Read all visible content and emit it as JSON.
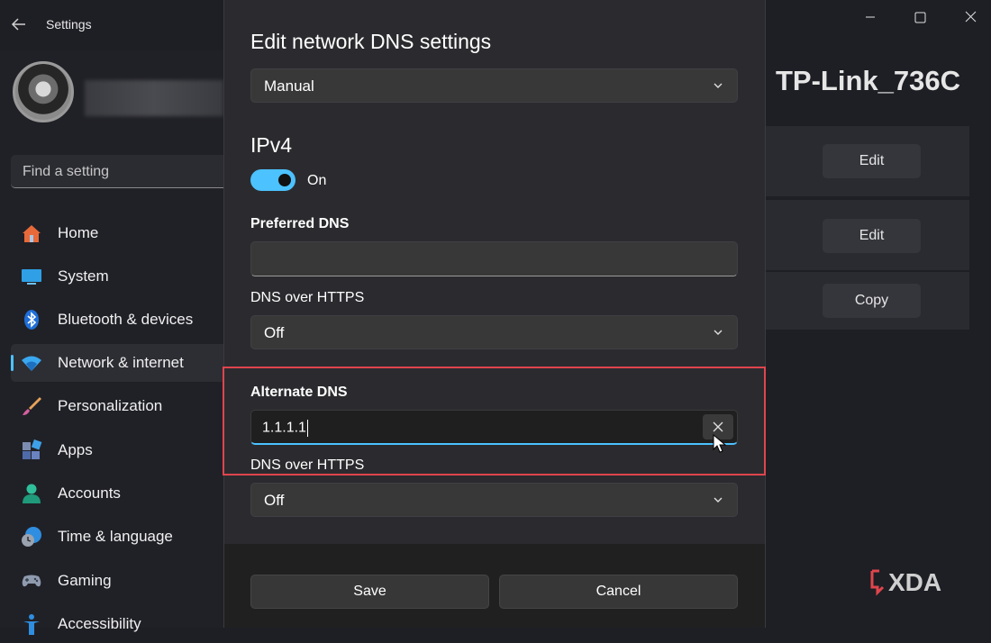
{
  "app": {
    "title": "Settings"
  },
  "search": {
    "placeholder": "Find a setting"
  },
  "sidebar": {
    "items": [
      {
        "label": "Home",
        "icon": "home-icon"
      },
      {
        "label": "System",
        "icon": "system-icon"
      },
      {
        "label": "Bluetooth & devices",
        "icon": "bluetooth-icon"
      },
      {
        "label": "Network & internet",
        "icon": "wifi-icon",
        "selected": true
      },
      {
        "label": "Personalization",
        "icon": "brush-icon"
      },
      {
        "label": "Apps",
        "icon": "apps-icon"
      },
      {
        "label": "Accounts",
        "icon": "person-icon"
      },
      {
        "label": "Time & language",
        "icon": "clock-globe-icon"
      },
      {
        "label": "Gaming",
        "icon": "gamepad-icon"
      },
      {
        "label": "Accessibility",
        "icon": "accessibility-icon"
      }
    ]
  },
  "background": {
    "heading": "TP-Link_736C",
    "buttons": [
      "Edit",
      "Edit",
      "Copy"
    ],
    "watermark": "XDA"
  },
  "dialog": {
    "title": "Edit network DNS settings",
    "mode": "Manual",
    "ipv4_title": "IPv4",
    "ipv4_toggle_label": "On",
    "ipv4_toggle_on": true,
    "preferred_dns_label": "Preferred DNS",
    "preferred_dns_value": "",
    "preferred_doh_label": "DNS over HTTPS",
    "preferred_doh_value": "Off",
    "alternate_dns_label": "Alternate DNS",
    "alternate_dns_value": "1.1.1.1",
    "alternate_doh_label": "DNS over HTTPS",
    "alternate_doh_value": "Off",
    "save_label": "Save",
    "cancel_label": "Cancel"
  },
  "colors": {
    "accent": "#4cc2ff",
    "highlight": "#e0454d",
    "dialog_bg": "#2b2b2f",
    "window_bg": "#1e1f25"
  }
}
